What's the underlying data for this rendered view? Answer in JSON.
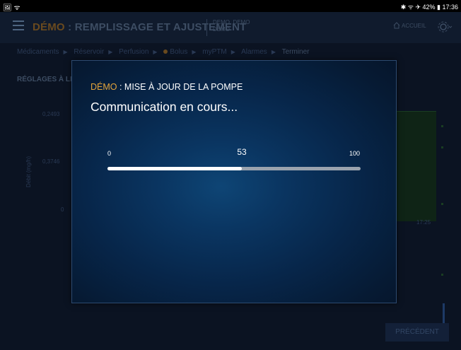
{
  "status_bar": {
    "left_icons": "🖼 ᯤ",
    "right_text": "✱ ᯤ ✈ 42% ▮ 17:36"
  },
  "header": {
    "demo_word": "DÉMO",
    "title_rest": " : REMPLISSAGE ET AJUSTEMENT",
    "patient_line1": "DEMO, DEMO",
    "patient_line2": "DEMO",
    "home_label": "ACCUEIL"
  },
  "breadcrumb": {
    "steps": [
      "Médicaments",
      "Réservoir",
      "Perfusion",
      "Bolus",
      "myPTM",
      "Alarmes",
      "Terminer"
    ],
    "current": "Terminer"
  },
  "background_content": {
    "section_title": "RÉGLAGES À LE",
    "y_ticks": [
      "0,2493",
      "0,3746",
      "0"
    ],
    "y_axis_label": "Débit (mg/h)",
    "time_label": "17:25",
    "previous_button": "PRÉCÉDENT"
  },
  "modal": {
    "demo_word": "DÉMO",
    "title_rest": " : MISE À JOUR DE LA POMPE",
    "message": "Communication en cours...",
    "progress": {
      "min": "0",
      "max": "100",
      "value": 53,
      "value_label": "53"
    }
  },
  "colors": {
    "accent_orange": "#e3a33a",
    "modal_blue": "#0a3561",
    "progress_fill": "#ffffff",
    "progress_track": "#9aa3ae"
  }
}
